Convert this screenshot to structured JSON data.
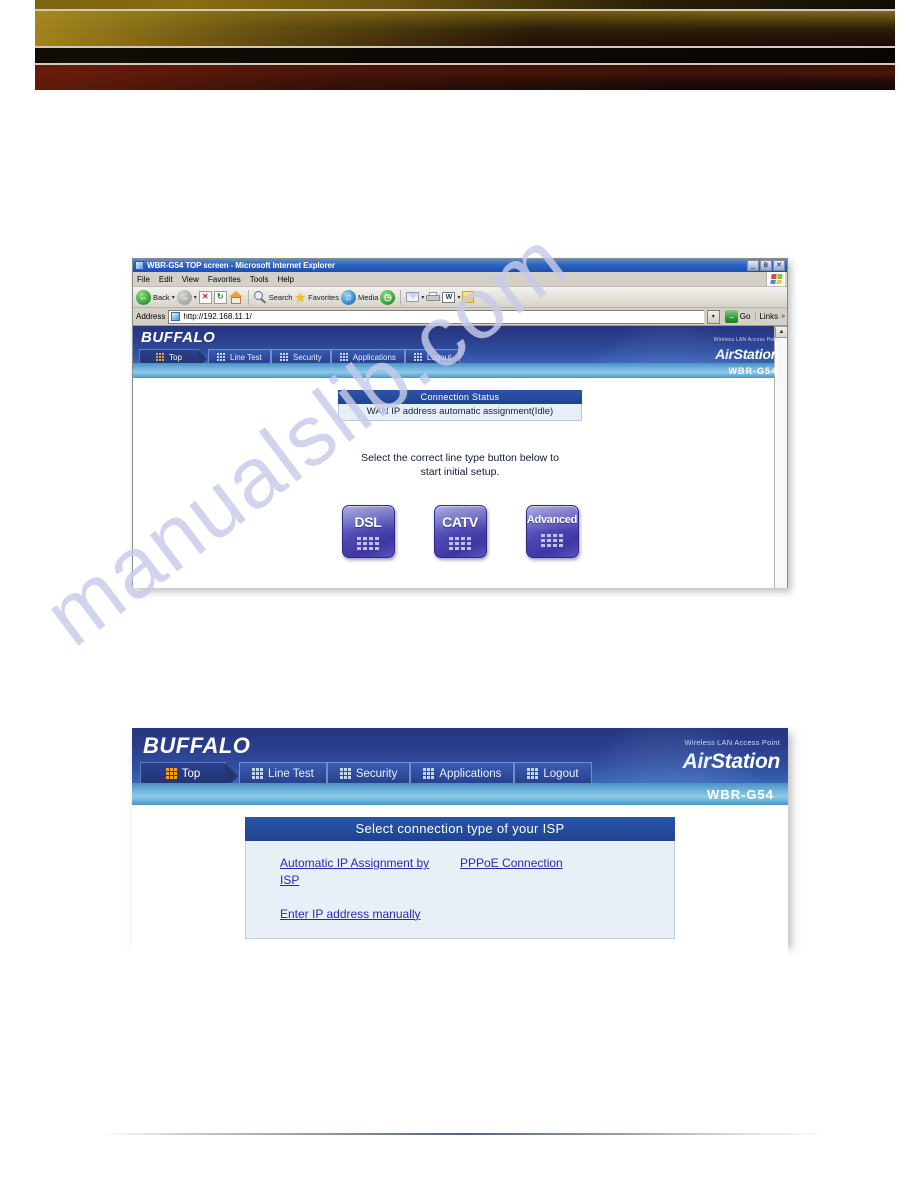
{
  "browser": {
    "title": "WBR-G54  TOP screen - Microsoft Internet Explorer",
    "window_buttons": {
      "minimize": "_",
      "restore": "฿",
      "close": "✕"
    },
    "menu": [
      "File",
      "Edit",
      "View",
      "Favorites",
      "Tools",
      "Help"
    ],
    "toolbar": {
      "back": "Back",
      "forward": "",
      "stop": "✕",
      "refresh": "↻",
      "home": "",
      "search": "Search",
      "favorites": "Favorites",
      "media": "Media",
      "history": "",
      "dropdown_caret": "▾"
    },
    "address": {
      "label": "Address",
      "url": "http://192.168.11.1/",
      "dropdown": "▾",
      "go_label": "Go",
      "go_arrow": "→",
      "links_label": "Links",
      "links_chevron": "»"
    },
    "scroll_up": "▲"
  },
  "airstation": {
    "logo": "BUFFALO",
    "brand_sub": "Wireless LAN Access Point",
    "brand_air": "Air",
    "brand_station": "Station",
    "model": "WBR-G54",
    "tabs": [
      {
        "label": "Top",
        "active": true
      },
      {
        "label": "Line Test",
        "active": false
      },
      {
        "label": "Security",
        "active": false
      },
      {
        "label": "Applications",
        "active": false
      },
      {
        "label": "Logout",
        "active": false
      }
    ]
  },
  "top_screen": {
    "status_header": "Connection Status",
    "status_value": "WAN IP address automatic assignment(Idle)",
    "instruction_line1": "Select the correct line type button below to",
    "instruction_line2": "start initial setup.",
    "buttons": [
      {
        "label": "DSL",
        "size": "large"
      },
      {
        "label": "CATV",
        "size": "large"
      },
      {
        "label": "Advanced",
        "size": "small"
      }
    ]
  },
  "isp_screen": {
    "header": "Select connection type of your ISP",
    "links": [
      "Automatic IP Assignment by ISP",
      "PPPoE Connection",
      "Enter IP address manually"
    ]
  },
  "watermark": {
    "text": "manualslib.com"
  },
  "colors": {
    "brand_blue": "#26357e",
    "panel_header": "#1f448f",
    "tab_active_dots": "#f3a024",
    "link": "#2a2ab0",
    "button_purple": "#4f48b4",
    "go_green": "#2f9b33"
  }
}
